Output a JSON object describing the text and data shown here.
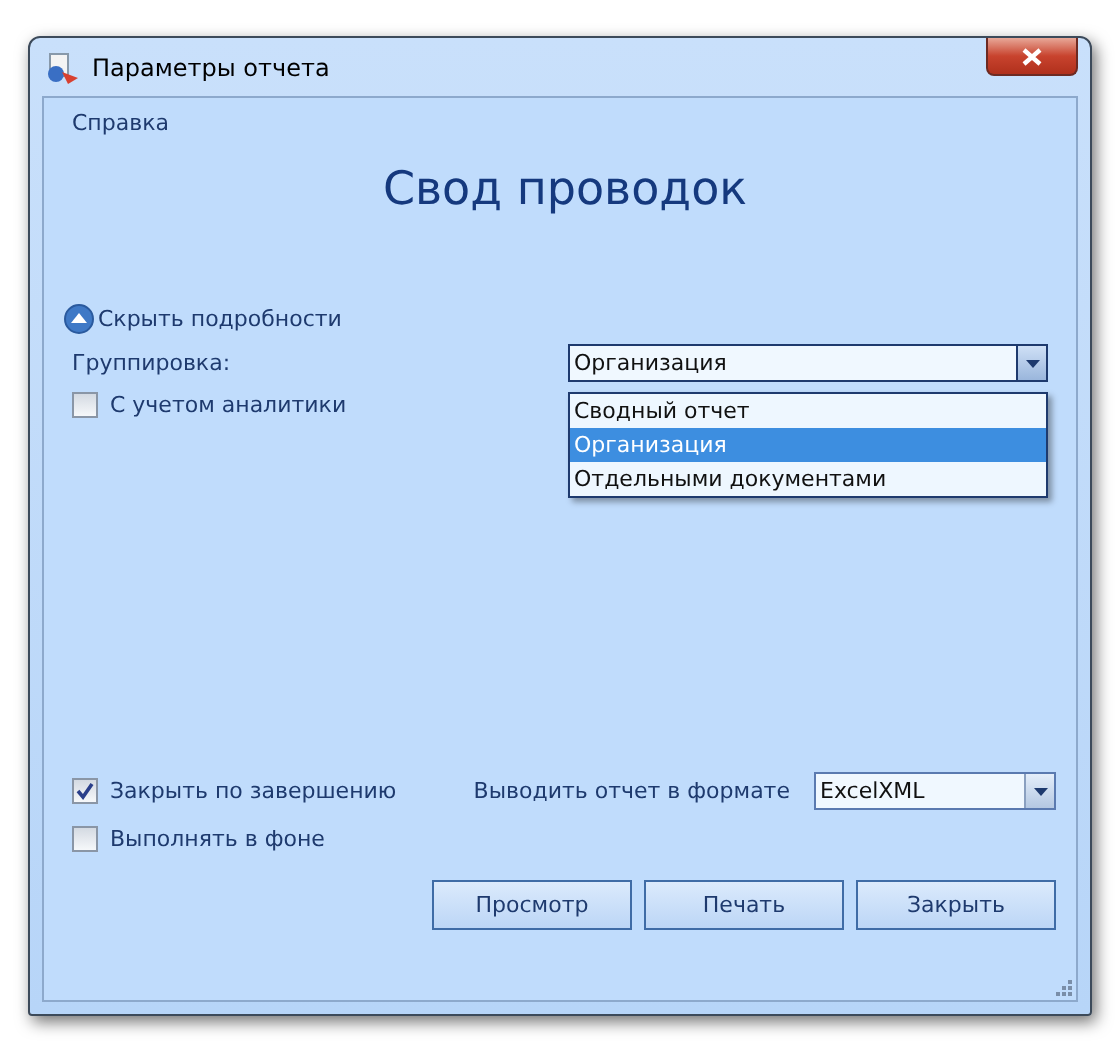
{
  "window": {
    "title": "Параметры отчета"
  },
  "menu": [
    {
      "label": "Справка"
    }
  ],
  "heading": "Свод проводок",
  "details_toggle": {
    "label": "Скрыть подробности",
    "expanded": true
  },
  "grouping": {
    "label": "Группировка:",
    "value": "Организация",
    "expanded": true,
    "options": [
      {
        "label": "Сводный отчет",
        "selected": false
      },
      {
        "label": "Организация",
        "selected": true
      },
      {
        "label": "Отдельными документами",
        "selected": false
      }
    ]
  },
  "top_checkboxes": [
    {
      "label": "С учетом аналитики",
      "checked": false
    }
  ],
  "bottom_checkboxes": [
    {
      "label": "Закрыть по завершению",
      "checked": true
    },
    {
      "label": "Выполнять в фоне",
      "checked": false
    }
  ],
  "format": {
    "label": "Выводить отчет в формате",
    "value": "ExcelXML"
  },
  "buttons": [
    {
      "label": "Просмотр"
    },
    {
      "label": "Печать"
    },
    {
      "label": "Закрыть"
    }
  ]
}
